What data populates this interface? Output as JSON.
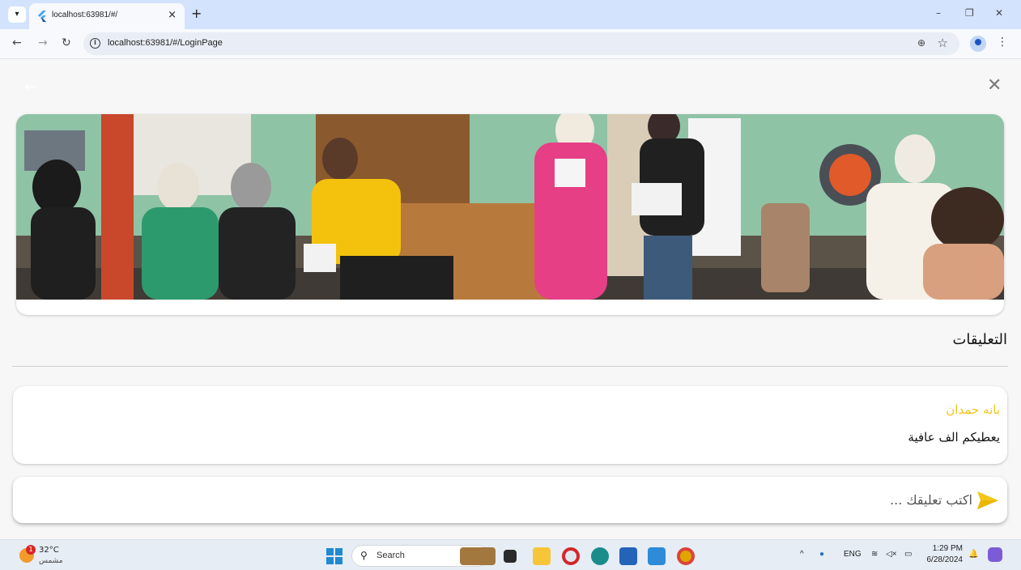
{
  "browser": {
    "tab_title": "localhost:63981/#/",
    "tab_close_glyph": "×",
    "new_tab_glyph": "+",
    "url": "localhost:63981/#/LoginPage",
    "minimize_glyph": "–",
    "restore_glyph": "❐",
    "close_glyph": "✕"
  },
  "app": {
    "comments_heading": "التعليقات",
    "comments": [
      {
        "author": "بانه حمدان",
        "text": "يعطيكم الف عافية"
      }
    ],
    "comment_input_placeholder": "اكتب تعليقك ...",
    "accent_color": "#f5c518"
  },
  "taskbar": {
    "weather_badge": "1",
    "weather_temp": "32°C",
    "weather_desc": "مشمس",
    "search_label": "Search",
    "lang": "ENG",
    "time": "1:29 PM",
    "date": "6/28/2024"
  }
}
